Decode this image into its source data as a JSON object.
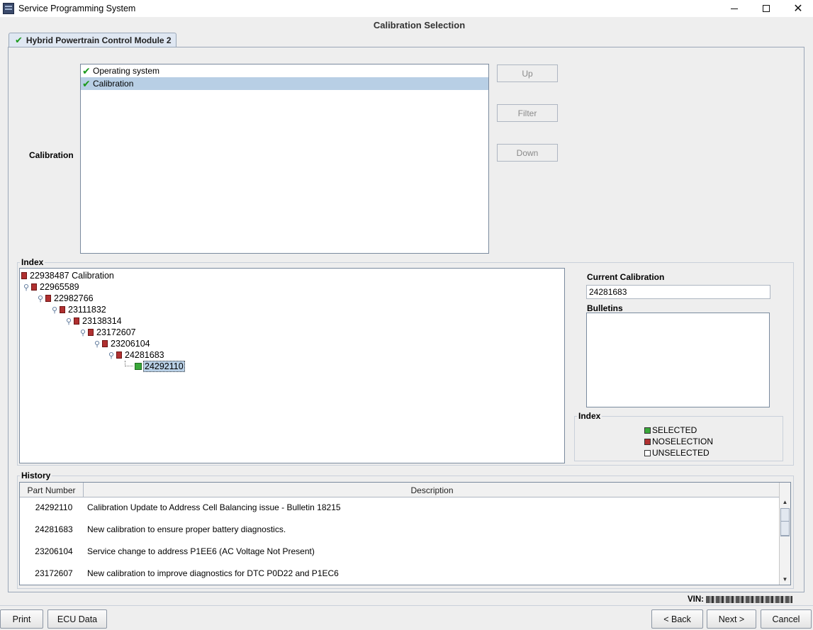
{
  "window": {
    "title": "Service Programming System",
    "controls": {
      "minimize": "—",
      "maximize": "☐",
      "close": "✕"
    }
  },
  "page_title": "Calibration Selection",
  "tab": {
    "label": "Hybrid Powertrain Control Module 2",
    "check": "✔"
  },
  "calibration": {
    "label": "Calibration",
    "items": [
      {
        "label": "Operating system",
        "check": "✔",
        "selected": false
      },
      {
        "label": "Calibration",
        "check": "✔",
        "selected": true
      }
    ],
    "buttons": {
      "up": "Up",
      "filter": "Filter",
      "down": "Down"
    }
  },
  "index": {
    "title": "Index",
    "tree": [
      {
        "label": "22938487 Calibration",
        "status": "noselection"
      },
      {
        "label": "22965589",
        "status": "noselection"
      },
      {
        "label": "22982766",
        "status": "noselection"
      },
      {
        "label": "23111832",
        "status": "noselection"
      },
      {
        "label": "23138314",
        "status": "noselection"
      },
      {
        "label": "23172607",
        "status": "noselection"
      },
      {
        "label": "23206104",
        "status": "noselection"
      },
      {
        "label": "24281683",
        "status": "noselection"
      },
      {
        "label": "24292110",
        "status": "selected"
      }
    ],
    "current_calibration_label": "Current Calibration",
    "current_calibration_value": "24281683",
    "bulletins_label": "Bulletins",
    "legend_title": "Index",
    "legend": [
      {
        "label": "SELECTED",
        "color": "#3aa83a"
      },
      {
        "label": "NOSELECTION",
        "color": "#b03030"
      },
      {
        "label": "UNSELECTED",
        "color": "#ffffff"
      }
    ]
  },
  "history": {
    "title": "History",
    "columns": [
      "Part Number",
      "Description"
    ],
    "rows": [
      {
        "part": "24292110",
        "description": "Calibration Update to Address Cell Balancing issue - Bulletin 18215"
      },
      {
        "part": "24281683",
        "description": "New calibration to ensure proper battery diagnostics."
      },
      {
        "part": "23206104",
        "description": "Service change to address P1EE6 (AC Voltage Not Present)"
      },
      {
        "part": "23172607",
        "description": "New calibration to improve diagnostics for DTC P0D22 and P1EC6"
      }
    ]
  },
  "vin_label": "VIN:",
  "footer": {
    "print": "Print",
    "ecu_data": "ECU Data",
    "back": "< Back",
    "next": "Next >",
    "cancel": "Cancel"
  },
  "colors": {
    "selection": "#b8cfe5",
    "check": "#1c9a1c",
    "noselection": "#b03030"
  }
}
